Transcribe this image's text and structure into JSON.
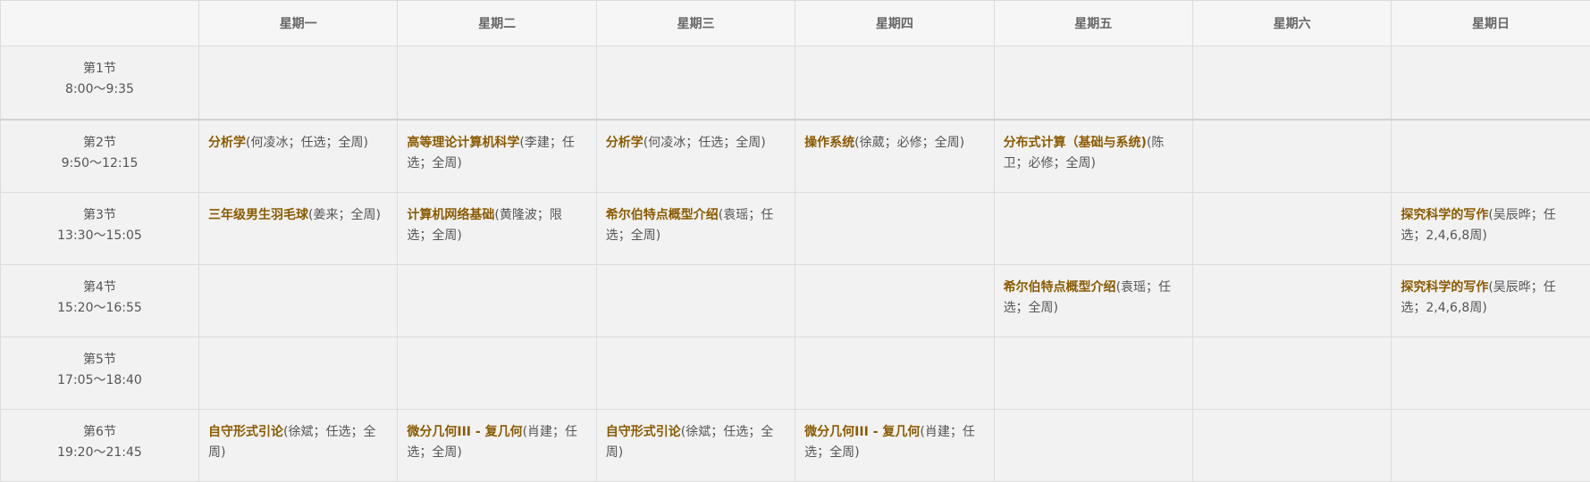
{
  "corner": "",
  "days": [
    "星期一",
    "星期二",
    "星期三",
    "星期四",
    "星期五",
    "星期六",
    "星期日"
  ],
  "periods": [
    {
      "name": "第1节",
      "time": "8:00～9:35"
    },
    {
      "name": "第2节",
      "time": "9:50～12:15"
    },
    {
      "name": "第3节",
      "time": "13:30～15:05"
    },
    {
      "name": "第4节",
      "time": "15:20～16:55"
    },
    {
      "name": "第5节",
      "time": "17:05～18:40"
    },
    {
      "name": "第6节",
      "time": "19:20～21:45"
    }
  ],
  "cells": {
    "r2": {
      "mon": {
        "name": "分析学",
        "info": "(何凌冰；任选；全周)"
      },
      "tue": {
        "name": "高等理论计算机科学",
        "info": "(李建；任选；全周)"
      },
      "wed": {
        "name": "分析学",
        "info": "(何凌冰；任选；全周)"
      },
      "thu": {
        "name": "操作系统",
        "info": "(徐葳；必修；全周)"
      },
      "fri": {
        "name": "分布式计算（基础与系统)",
        "info": "(陈卫；必修；全周)"
      }
    },
    "r3": {
      "mon": {
        "name": "三年级男生羽毛球",
        "info": "(姜来；全周)"
      },
      "tue": {
        "name": "计算机网络基础",
        "info": "(黄隆波；限选；全周)"
      },
      "wed": {
        "name": "希尔伯特点概型介绍",
        "info": "(袁瑶；任选；全周)"
      },
      "sun": {
        "name": "探究科学的写作",
        "info": "(吴辰晔；任选；2,4,6,8周)"
      }
    },
    "r4": {
      "fri": {
        "name": "希尔伯特点概型介绍",
        "info": "(袁瑶；任选；全周)"
      },
      "sun": {
        "name": "探究科学的写作",
        "info": "(吴辰晔；任选；2,4,6,8周)"
      }
    },
    "r6": {
      "mon": {
        "name": "自守形式引论",
        "info": "(徐斌；任选；全周)"
      },
      "tue": {
        "name": "微分几何III - 复几何",
        "info": "(肖建；任选；全周)"
      },
      "wed": {
        "name": "自守形式引论",
        "info": "(徐斌；任选；全周)"
      },
      "thu": {
        "name": "微分几何III - 复几何",
        "info": "(肖建；任选；全周)"
      }
    }
  }
}
